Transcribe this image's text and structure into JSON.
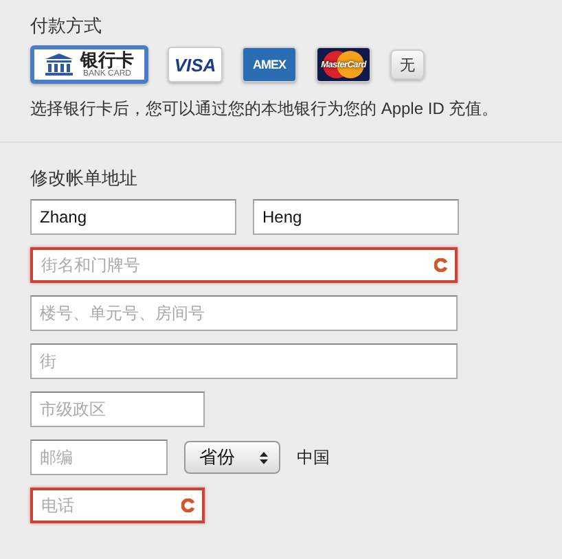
{
  "payment": {
    "title": "付款方式",
    "methods": [
      {
        "kind": "bank",
        "label": "银行卡",
        "sublabel": "BANK CARD",
        "selected": true
      },
      {
        "kind": "visa",
        "label": "VISA",
        "selected": false
      },
      {
        "kind": "amex",
        "label": "AMEX",
        "selected": false
      },
      {
        "kind": "mastercard",
        "label": "MasterCard",
        "selected": false
      },
      {
        "kind": "none",
        "label": "无",
        "selected": false
      }
    ],
    "note": "选择银行卡后，您可以通过您的本地银行为您的 Apple ID 充值。"
  },
  "billing": {
    "title": "修改帐单地址",
    "rows": [
      [
        {
          "kind": "input",
          "value": "Zhang",
          "error": false
        },
        {
          "kind": "input",
          "value": "Heng",
          "error": false
        }
      ],
      [
        {
          "kind": "input",
          "placeholder": "街名和门牌号",
          "error": true
        }
      ],
      [
        {
          "kind": "input",
          "placeholder": "楼号、单元号、房间号",
          "error": false
        }
      ],
      [
        {
          "kind": "input",
          "placeholder": "街",
          "error": false
        }
      ],
      [
        {
          "kind": "input",
          "placeholder": "市级政区",
          "error": false
        }
      ],
      [
        {
          "kind": "input",
          "placeholder": "邮编",
          "error": false
        },
        {
          "kind": "select",
          "value": "省份"
        },
        {
          "kind": "label",
          "text": "中国"
        }
      ],
      [
        {
          "kind": "input",
          "placeholder": "电话",
          "error": true
        }
      ]
    ]
  }
}
